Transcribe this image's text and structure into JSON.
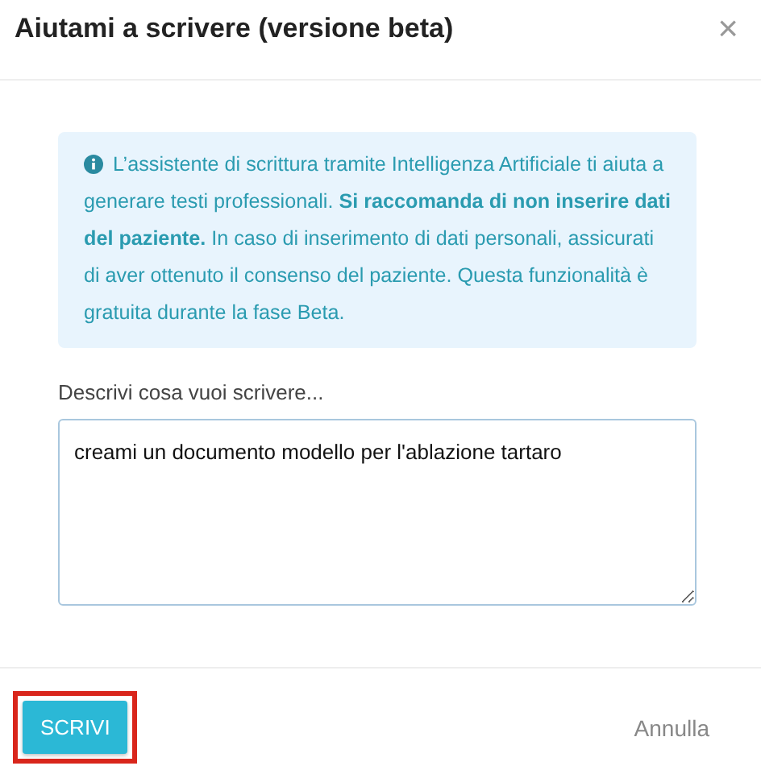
{
  "dialog": {
    "title": "Aiutami a scrivere (versione beta)",
    "close": "×"
  },
  "notice": {
    "text": "L’assistente di scrittura tramite Intelligenza Artificiale ti aiuta a generare testi professionali. **Si raccomanda di non inserire dati del paziente.** In caso di inserimento di dati personali, assicurati di aver ottenuto il consenso del paziente. Questa funzionalità è gratuita durante la fase Beta."
  },
  "prompt": {
    "label": "Descrivi cosa vuoi scrivere...",
    "value": "creami un documento modello per l'ablazione tartaro"
  },
  "buttons": [
    {
      "label": "SCRIVI",
      "kind": "primary",
      "highlighted": true
    },
    {
      "label": "Annulla",
      "kind": "text",
      "highlighted": false
    }
  ]
}
